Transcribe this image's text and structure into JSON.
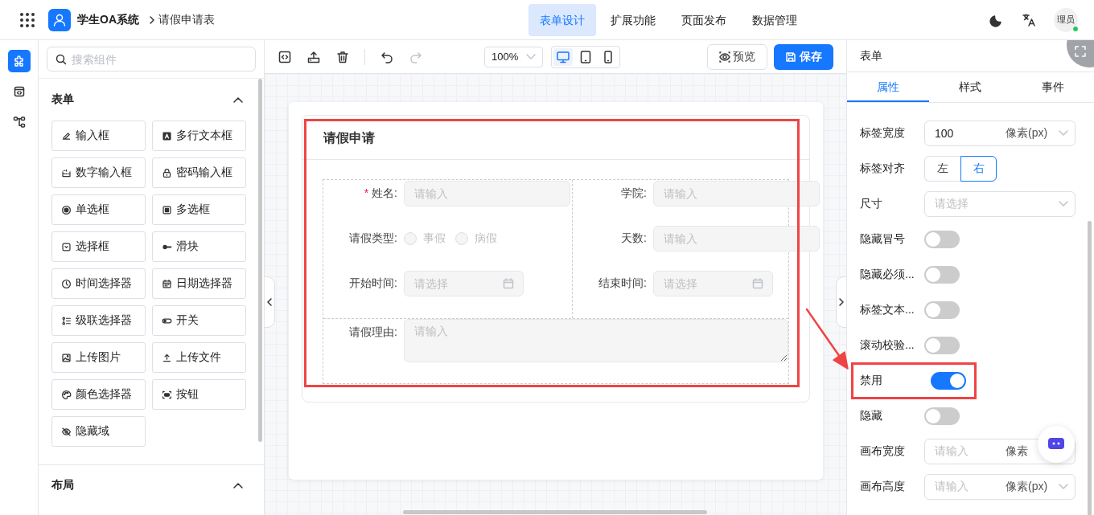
{
  "header": {
    "title": "学生OA系统",
    "breadcrumb": "请假申请表",
    "nav": [
      {
        "label": "表单设计",
        "selected": true
      },
      {
        "label": "扩展功能",
        "selected": false
      },
      {
        "label": "页面发布",
        "selected": false
      },
      {
        "label": "数据管理",
        "selected": false
      }
    ],
    "avatar": "理员",
    "online": true
  },
  "rail": [
    {
      "selected": true
    },
    {
      "selected": false
    },
    {
      "selected": false
    }
  ],
  "components": {
    "search_placeholder": "搜索组件",
    "sections": [
      {
        "title": "表单",
        "expanded": true,
        "items": [
          "输入框",
          "多行文本框",
          "数字输入框",
          "密码输入框",
          "单选框",
          "多选框",
          "选择框",
          "滑块",
          "时间选择器",
          "日期选择器",
          "级联选择器",
          "开关",
          "上传图片",
          "上传文件",
          "颜色选择器",
          "按钮",
          "隐藏域"
        ]
      },
      {
        "title": "布局",
        "expanded": true
      }
    ]
  },
  "toolbar": {
    "zoom": "100%",
    "devices": [
      {
        "selected": true
      },
      {
        "selected": false
      },
      {
        "selected": false
      }
    ],
    "preview": "预览",
    "save": "保存"
  },
  "form": {
    "title": "请假申请",
    "highlighted": true,
    "disabled": true,
    "fields": [
      {
        "kind": "input",
        "label": "姓名:",
        "required_mark": "*",
        "placeholder": "请输入"
      },
      {
        "kind": "input",
        "label": "学院:",
        "placeholder": "请输入"
      },
      {
        "kind": "radio",
        "label": "请假类型:",
        "options": [
          {
            "label": "事假",
            "checked": false
          },
          {
            "label": "病假",
            "checked": false
          }
        ]
      },
      {
        "kind": "input",
        "label": "天数:",
        "placeholder": "请输入"
      },
      {
        "kind": "date",
        "label": "开始时间:",
        "placeholder": "请选择"
      },
      {
        "kind": "date",
        "label": "结束时间:",
        "placeholder": "请选择"
      },
      {
        "kind": "textarea",
        "label": "请假理由:",
        "placeholder": "请输入"
      }
    ]
  },
  "props": {
    "title": "表单",
    "tabs": [
      {
        "label": "属性",
        "selected": true
      },
      {
        "label": "样式",
        "selected": false
      },
      {
        "label": "事件",
        "selected": false
      }
    ],
    "rows": [
      {
        "kind": "select",
        "label": "标签宽度",
        "value": "100",
        "unit": "像素(px)",
        "caret": true
      },
      {
        "kind": "segmented",
        "label": "标签对齐",
        "options": [
          {
            "label": "左",
            "selected": false
          },
          {
            "label": "右",
            "selected": true
          }
        ]
      },
      {
        "kind": "select",
        "label": "尺寸",
        "placeholder": "请选择",
        "caret": true
      },
      {
        "kind": "switch",
        "label": "隐藏冒号",
        "on": false
      },
      {
        "kind": "switch",
        "label": "隐藏必须...",
        "on": false
      },
      {
        "kind": "switch",
        "label": "标签文本...",
        "on": false
      },
      {
        "kind": "switch",
        "label": "滚动校验...",
        "on": false
      },
      {
        "kind": "switch",
        "label": "禁用",
        "on": true,
        "highlighted": true
      },
      {
        "kind": "switch",
        "label": "隐藏",
        "on": false
      },
      {
        "kind": "select",
        "label": "画布宽度",
        "placeholder": "请输入",
        "unit": "像素"
      },
      {
        "kind": "select",
        "label": "画布高度",
        "placeholder": "请输入",
        "unit": "像素(px)",
        "caret": true
      }
    ]
  }
}
